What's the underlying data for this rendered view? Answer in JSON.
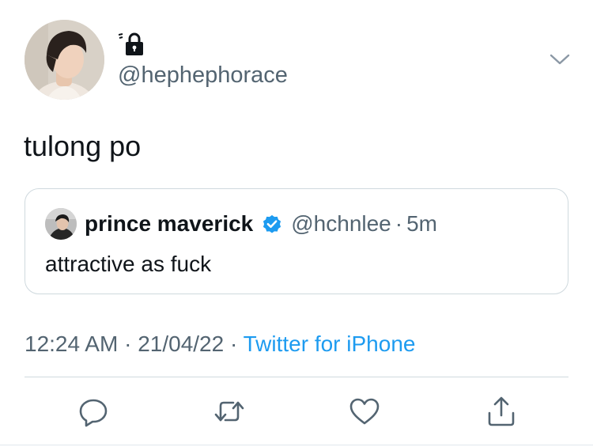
{
  "author": {
    "handle": "@hephephorace",
    "avatar_icon": "profile-photo",
    "protected_icon": "lock-icon"
  },
  "tweet": {
    "text": "tulong po"
  },
  "quoted_tweet": {
    "name": "prince maverick",
    "verified_icon": "verified-badge-icon",
    "handle": "@hchnlee",
    "separator": "·",
    "time": "5m",
    "text": "attractive as fuck"
  },
  "meta": {
    "time": "12:24 AM",
    "separator1": " · ",
    "date": "21/04/22",
    "separator2": " · ",
    "source": "Twitter for iPhone"
  },
  "actions": [
    {
      "icon": "reply-icon"
    },
    {
      "icon": "retweet-icon"
    },
    {
      "icon": "like-icon"
    },
    {
      "icon": "share-icon"
    }
  ],
  "colors": {
    "text_primary": "#0f1419",
    "text_secondary": "#536471",
    "link_blue": "#1d9bf0",
    "border": "#cfd9de",
    "verified_blue": "#1d9bf0"
  }
}
